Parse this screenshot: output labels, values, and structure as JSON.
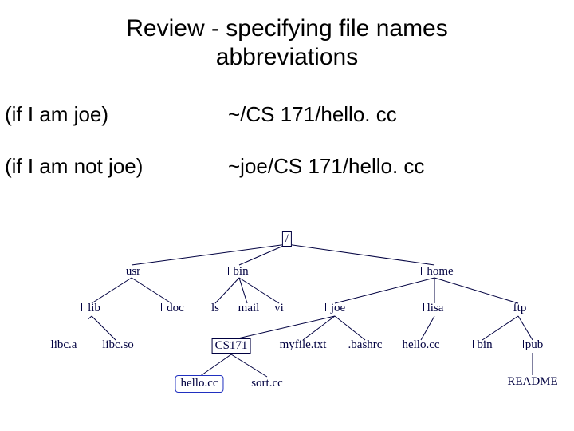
{
  "title_line1": "Review - specifying file names",
  "title_line2": "abbreviations",
  "row1": {
    "label": "(if I am joe)",
    "path": "~/CS 171/hello. cc"
  },
  "row2": {
    "label": "(if I am not joe)",
    "path": "~joe/CS 171/hello. cc"
  },
  "tree": {
    "root": "/",
    "usr": "usr",
    "bin": "bin",
    "home": "home",
    "lib": "lib",
    "doc": "doc",
    "ls": "ls",
    "mail": "mail",
    "vi": "vi",
    "joe": "joe",
    "lisa": "lisa",
    "ftp": "ftp",
    "libc_a": "libc.a",
    "libc_so": "libc.so",
    "cs171": "CS171",
    "myfile": "myfile.txt",
    "bashrc": ".bashrc",
    "hello_lisa": "hello.cc",
    "bin2": "bin",
    "pub": "pub",
    "hello": "hello.cc",
    "sort": "sort.cc",
    "readme": "README"
  }
}
